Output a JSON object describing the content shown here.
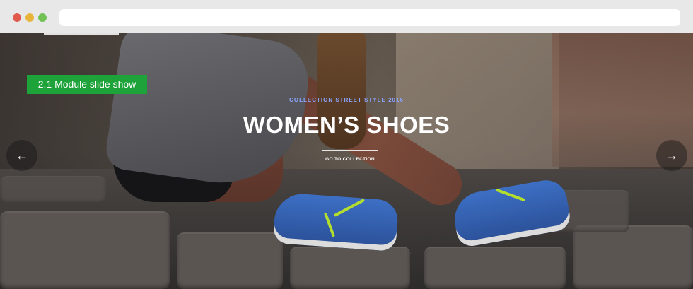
{
  "browser": {
    "window_controls": [
      "close",
      "minimize",
      "maximize"
    ],
    "address_value": ""
  },
  "annotation": {
    "label": "2.1 Module slide show",
    "color": "#1ea23a"
  },
  "slide": {
    "eyebrow": "COLLECTION STREET STYLE 2016",
    "title": "WOMEN’S SHOES",
    "cta_label": "GO TO COLLECTION",
    "eyebrow_color": "#8aa4ff"
  },
  "nav": {
    "prev_icon": "arrow-left-icon",
    "next_icon": "arrow-right-icon",
    "prev_glyph": "←",
    "next_glyph": "→"
  }
}
